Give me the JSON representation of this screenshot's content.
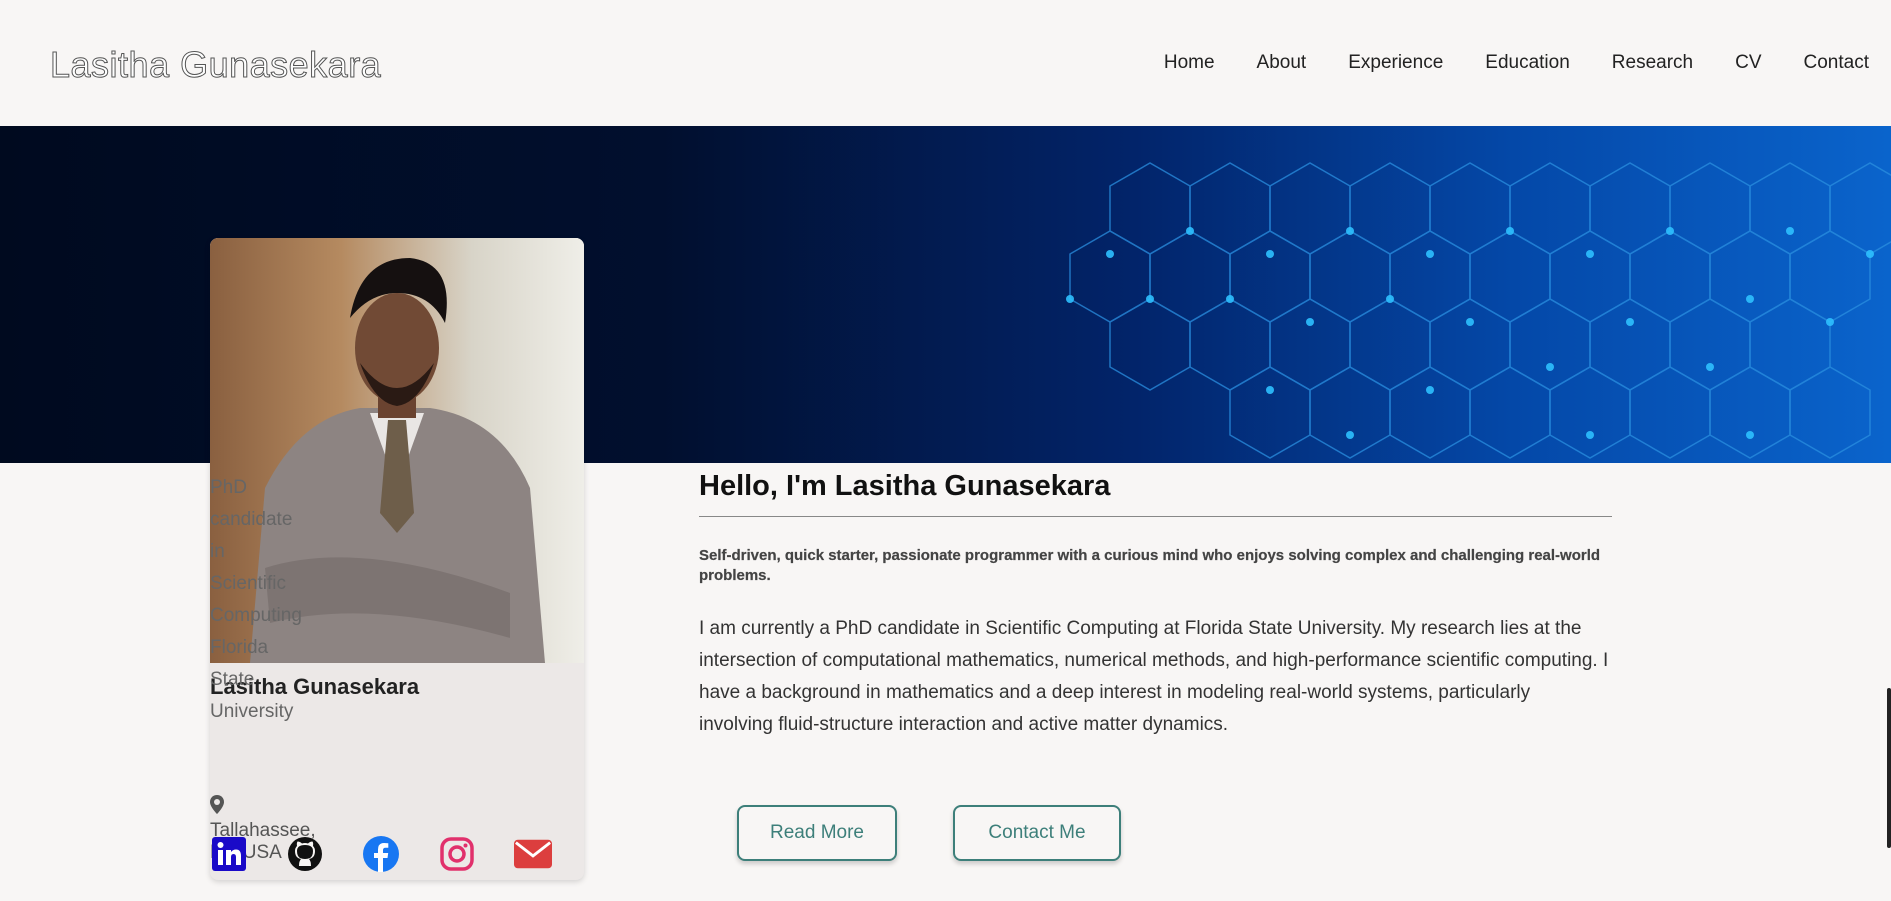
{
  "header": {
    "brand": "Lasitha Gunasekara",
    "nav": [
      "Home",
      "About",
      "Experience",
      "Education",
      "Research",
      "CV",
      "Contact"
    ]
  },
  "profile": {
    "name": "Lasitha Gunasekara",
    "role_line1": "PhD candidate in Scientific Computing",
    "role_line2": "Florida State University",
    "location": "Tallahassee, FL, USA",
    "socials": [
      "linkedin-icon",
      "github-icon",
      "facebook-icon",
      "instagram-icon",
      "email-icon"
    ]
  },
  "main": {
    "greeting": "Hello, I'm Lasitha Gunasekara",
    "tagline": "Self-driven, quick starter, passionate programmer with a curious mind who enjoys solving complex and challenging real-world problems.",
    "bio": "I am currently a PhD candidate in Scientific Computing at Florida State University. My research lies at the intersection of computational mathematics, numerical methods, and high-performance scientific computing. I have a background in mathematics and a deep interest in modeling real-world systems, particularly involving fluid-structure interaction and active matter dynamics.",
    "read_more": "Read More",
    "contact_me": "Contact Me"
  },
  "colors": {
    "accent": "#3d7f7a",
    "background": "#f8f6f5",
    "banner_dark": "#000a1f",
    "banner_light": "#0a64cc"
  }
}
